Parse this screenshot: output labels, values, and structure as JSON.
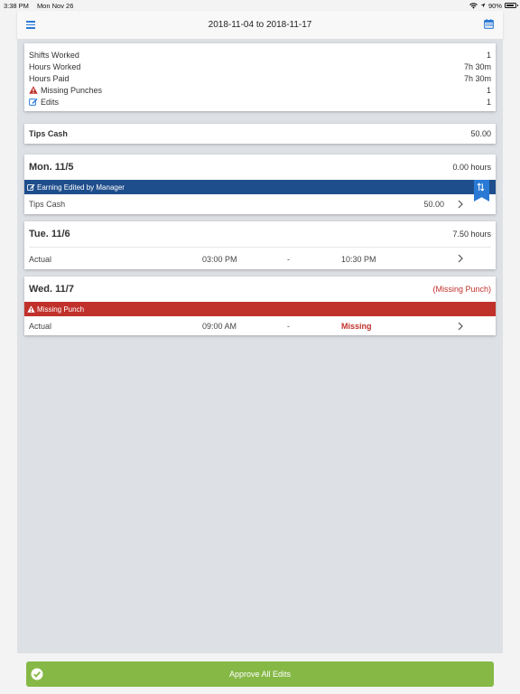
{
  "status_bar": {
    "time": "3:38 PM",
    "date": "Mon Nov 26",
    "battery": "90%"
  },
  "header": {
    "title": "2018-11-04 to 2018-11-17"
  },
  "summary": {
    "items": [
      {
        "label": "Shifts Worked",
        "value": "1"
      },
      {
        "label": "Hours Worked",
        "value": "7h 30m"
      },
      {
        "label": "Hours Paid",
        "value": "7h 30m"
      },
      {
        "label": "Missing Punches",
        "value": "1",
        "icon": "warning-icon"
      },
      {
        "label": "Edits",
        "value": "1",
        "icon": "edit-icon"
      }
    ]
  },
  "tips_total": {
    "label": "Tips Cash",
    "value": "50.00"
  },
  "days": [
    {
      "day": "Mon. 11/5",
      "hours": "0.00 hours",
      "banner": "Earning Edited by Manager",
      "detail": {
        "label": "Tips Cash",
        "value": "50.00"
      }
    },
    {
      "day": "Tue. 11/6",
      "hours": "7.50 hours",
      "detail": {
        "label": "Actual",
        "start": "03:00 PM",
        "dash": "-",
        "end": "10:30 PM"
      }
    },
    {
      "day": "Wed. 11/7",
      "hours": "(Missing Punch)",
      "banner": "Missing Punch",
      "detail": {
        "label": "Actual",
        "start": "09:00 AM",
        "dash": "-",
        "end": "Missing"
      }
    }
  ],
  "footer": {
    "approve_label": "Approve All Edits"
  },
  "colors": {
    "accent": "#2a7ad5",
    "edited_banner": "#1f4e8c",
    "missing_banner": "#c0312b",
    "approve": "#86b846",
    "missing_text": "#c0312b"
  }
}
